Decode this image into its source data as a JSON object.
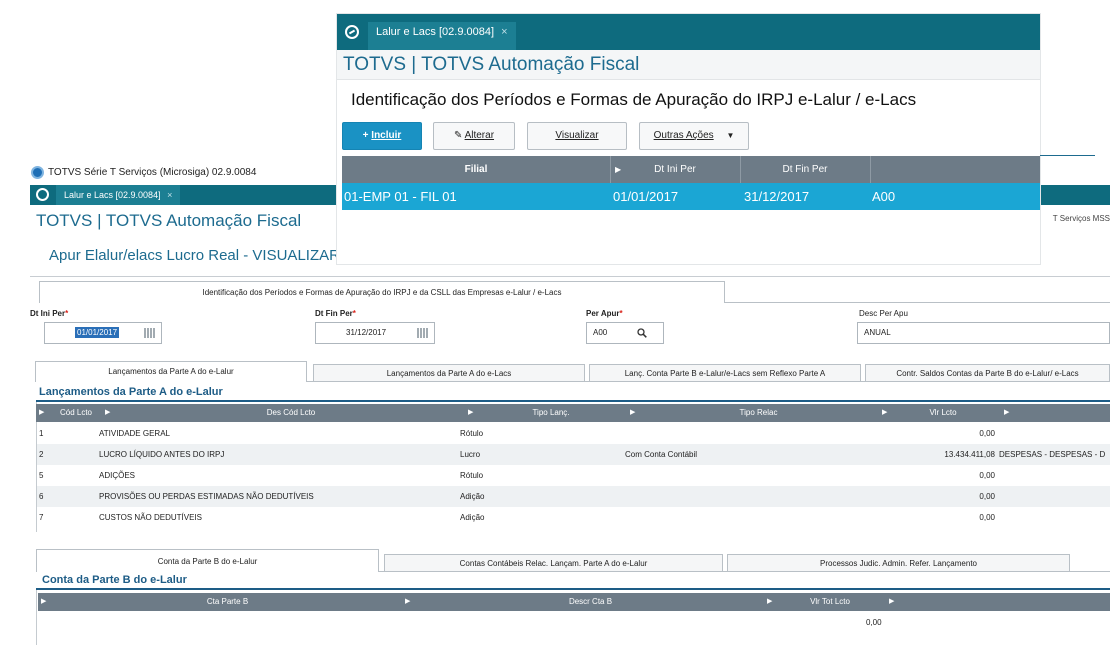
{
  "back_window": {
    "os_title": "TOTVS Série T Serviços (Microsiga) 02.9.0084",
    "tab_label": "Lalur e Lacs [02.9.0084]",
    "tab_close": "×",
    "app_title": "TOTVS | TOTVS Automação Fiscal",
    "server_info": "T Serviços MSS",
    "page_title": "Apur Elalur/elacs Lucro Real - VISUALIZAR",
    "section_tab": "Identificação dos Períodos e Formas de Apuração do IRPJ e da CSLL das Empresas e-Lalur / e-Lacs",
    "fields": {
      "dt_ini_label": "Dt Ini Per",
      "dt_ini_value": "01/01/2017",
      "dt_fin_label": "Dt Fin Per",
      "dt_fin_value": "31/12/2017",
      "per_apur_label": "Per Apur",
      "per_apur_value": "A00",
      "desc_per_label": "Desc Per Apu",
      "desc_per_value": "ANUAL",
      "required_mark": "*"
    },
    "sub_tabs": [
      "Lançamentos da Parte A do e-Lalur",
      "Lançamentos da Parte A do e-Lacs",
      "Lanç. Conta Parte B e-Lalur/e-Lacs sem Reflexo Parte A",
      "Contr. Saldos Contas da Parte B do e-Lalur/ e-Lacs"
    ],
    "grid_a": {
      "title": "Lançamentos da Parte A do e-Lalur",
      "columns": [
        "Cód Lcto",
        "Des Cód Lcto",
        "Tipo Lanç.",
        "Tipo Relac",
        "Vlr Lcto"
      ],
      "rows": [
        {
          "cod": "1",
          "desc": "ATIVIDADE GERAL",
          "tipo": "Rótulo",
          "relac": "",
          "vlr": "0,00",
          "extra": ""
        },
        {
          "cod": "2",
          "desc": "LUCRO LÍQUIDO ANTES DO IRPJ",
          "tipo": "Lucro",
          "relac": "Com Conta Contábil",
          "vlr": "13.434.411,08",
          "extra": "DESPESAS - DESPESAS - D"
        },
        {
          "cod": "5",
          "desc": "ADIÇÕES",
          "tipo": "Rótulo",
          "relac": "",
          "vlr": "0,00",
          "extra": ""
        },
        {
          "cod": "6",
          "desc": "PROVISÕES OU PERDAS ESTIMADAS NÃO DEDUTÍVEIS",
          "tipo": "Adição",
          "relac": "",
          "vlr": "0,00",
          "extra": ""
        },
        {
          "cod": "7",
          "desc": "CUSTOS NÃO DEDUTÍVEIS",
          "tipo": "Adição",
          "relac": "",
          "vlr": "0,00",
          "extra": ""
        }
      ]
    },
    "lower_tabs": [
      "Conta da Parte B do e-Lalur",
      "Contas Contábeis Relac. Lançam. Parte A do e-Lalur",
      "Processos Judic. Admin. Refer. Lançamento"
    ],
    "grid_b": {
      "title": "Conta da Parte B do e-Lalur",
      "columns": [
        "Cta Parte B",
        "Descr Cta B",
        "Vlr Tot Lcto"
      ],
      "rows": [
        {
          "vlr": "0,00"
        }
      ]
    }
  },
  "front_window": {
    "tab_label": "Lalur e Lacs [02.9.0084]",
    "tab_close": "×",
    "app_title": "TOTVS | TOTVS Automação Fiscal",
    "page_title": "Identificação dos Períodos e Formas de Apuração do IRPJ e-Lalur / e-Lacs",
    "buttons": {
      "incluir": "Incluir",
      "alterar": "Alterar",
      "visualizar": "Visualizar",
      "outras": "Outras Ações"
    },
    "grid": {
      "columns": [
        "Filial",
        "Dt Ini Per",
        "Dt Fin Per"
      ],
      "row": {
        "filial": "01-EMP 01 - FIL 01",
        "dt_ini": "01/01/2017",
        "dt_fin": "31/12/2017",
        "per": "A00"
      }
    }
  },
  "colors": {
    "tab_bar": "#0e6b7e",
    "primary_button": "#1a92c4",
    "selected_row": "#1ba6d4",
    "grid_header": "#6d7b87",
    "title_blue": "#1d6b8f"
  }
}
